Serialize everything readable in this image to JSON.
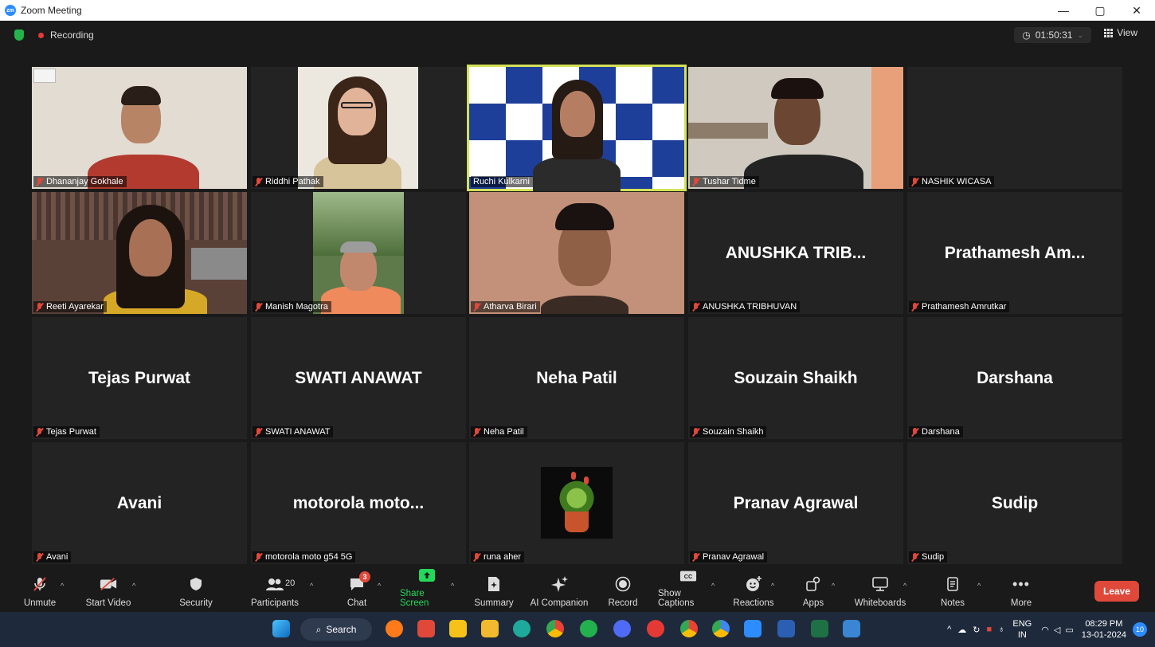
{
  "window": {
    "title": "Zoom Meeting",
    "minimize": "—",
    "maximize": "▢",
    "close": "✕"
  },
  "topbar": {
    "recording_label": "Recording",
    "timer": "01:50:31",
    "view_label": "View"
  },
  "tiles": [
    {
      "label": "Dhananjay Gokhale",
      "video": true
    },
    {
      "label": "Riddhi Pathak",
      "video": true
    },
    {
      "label": "Ruchi Kulkarni",
      "video": true,
      "active": true
    },
    {
      "label": "Tushar Tidme",
      "video": true
    },
    {
      "label": "NASHIK WICASA",
      "video": false,
      "display": ""
    },
    {
      "label": "Reeti Ayarekar",
      "video": true
    },
    {
      "label": "Manish Magotra",
      "video": true
    },
    {
      "label": "Atharva Birari",
      "video": true
    },
    {
      "label": "ANUSHKA TRIBHUVAN",
      "video": false,
      "display": "ANUSHKA TRIB..."
    },
    {
      "label": "Prathamesh Amrutkar",
      "video": false,
      "display": "Prathamesh Am..."
    },
    {
      "label": "Tejas Purwat",
      "video": false,
      "display": "Tejas Purwat"
    },
    {
      "label": "SWATI ANAWAT",
      "video": false,
      "display": "SWATI ANAWAT"
    },
    {
      "label": "Neha Patil",
      "video": false,
      "display": "Neha Patil"
    },
    {
      "label": "Souzain Shaikh",
      "video": false,
      "display": "Souzain Shaikh"
    },
    {
      "label": "Darshana",
      "video": false,
      "display": "Darshana"
    },
    {
      "label": "Avani",
      "video": false,
      "display": "Avani"
    },
    {
      "label": "motorola moto g54 5G",
      "video": false,
      "display": "motorola moto..."
    },
    {
      "label": "runa aher",
      "video": false,
      "display": "",
      "avatar": "plant"
    },
    {
      "label": "Pranav Agrawal",
      "video": false,
      "display": "Pranav Agrawal"
    },
    {
      "label": "Sudip",
      "video": false,
      "display": "Sudip"
    }
  ],
  "toolbar": {
    "unmute": "Unmute",
    "start_video": "Start Video",
    "security": "Security",
    "participants": "Participants",
    "participants_count": "20",
    "chat": "Chat",
    "chat_badge": "3",
    "share_screen": "Share Screen",
    "summary": "Summary",
    "ai_companion": "AI Companion",
    "record": "Record",
    "show_captions": "Show Captions",
    "reactions": "Reactions",
    "apps": "Apps",
    "whiteboards": "Whiteboards",
    "notes": "Notes",
    "more": "More",
    "leave": "Leave"
  },
  "taskbar": {
    "search_label": "Search",
    "lang_line1": "ENG",
    "lang_line2": "IN",
    "time": "08:29 PM",
    "date": "13-01-2024",
    "notif_count": "10"
  },
  "colors": {
    "accent": "#2d8cff",
    "leave": "#e0483a",
    "share": "#23d959",
    "active_speaker": "#d4e157"
  }
}
